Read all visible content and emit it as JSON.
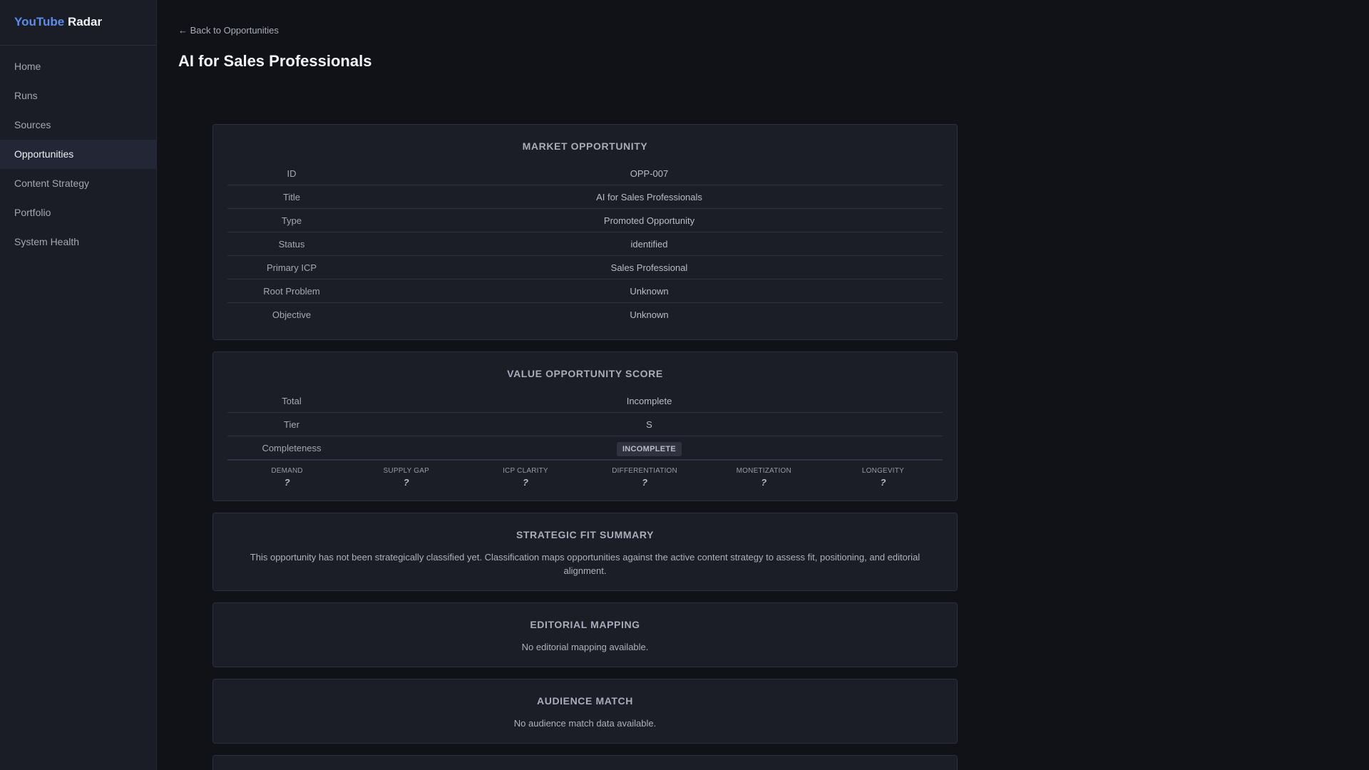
{
  "brand": {
    "part1": "YouTube",
    "part2": "Radar"
  },
  "sidebar": {
    "items": [
      {
        "label": "Home"
      },
      {
        "label": "Runs"
      },
      {
        "label": "Sources"
      },
      {
        "label": "Opportunities",
        "active": true
      },
      {
        "label": "Content Strategy"
      },
      {
        "label": "Portfolio"
      },
      {
        "label": "System Health"
      }
    ]
  },
  "header": {
    "back_link": "← Back to Opportunities",
    "title": "AI for Sales Professionals"
  },
  "market_opportunity": {
    "title": "MARKET OPPORTUNITY",
    "rows": [
      {
        "key": "ID",
        "value": "OPP-007"
      },
      {
        "key": "Title",
        "value": "AI for Sales Professionals"
      },
      {
        "key": "Type",
        "value": "Promoted Opportunity"
      },
      {
        "key": "Status",
        "value": "identified"
      },
      {
        "key": "Primary ICP",
        "value": "Sales Professional"
      },
      {
        "key": "Root Problem",
        "value": "Unknown"
      },
      {
        "key": "Objective",
        "value": "Unknown"
      }
    ]
  },
  "value_score": {
    "title": "VALUE OPPORTUNITY SCORE",
    "rows": [
      {
        "key": "Total",
        "value": "Incomplete"
      },
      {
        "key": "Tier",
        "value": "S"
      },
      {
        "key": "Completeness",
        "value": "INCOMPLETE"
      }
    ],
    "dimensions": [
      {
        "label": "DEMAND",
        "value": "?"
      },
      {
        "label": "SUPPLY GAP",
        "value": "?"
      },
      {
        "label": "ICP CLARITY",
        "value": "?"
      },
      {
        "label": "DIFFERENTIATION",
        "value": "?"
      },
      {
        "label": "MONETIZATION",
        "value": "?"
      },
      {
        "label": "LONGEVITY",
        "value": "?"
      }
    ]
  },
  "strategic_fit": {
    "title": "STRATEGIC FIT SUMMARY",
    "text": "This opportunity has not been strategically classified yet. Classification maps opportunities against the active content strategy to assess fit, positioning, and editorial alignment."
  },
  "editorial_mapping": {
    "title": "EDITORIAL MAPPING",
    "text": "No editorial mapping available."
  },
  "audience_match": {
    "title": "AUDIENCE MATCH",
    "text": "No audience match data available."
  },
  "colors": {
    "accent": "#5b8def",
    "background": "#111217",
    "sidebar": "#1a1c26",
    "card": "#1b1d27"
  }
}
